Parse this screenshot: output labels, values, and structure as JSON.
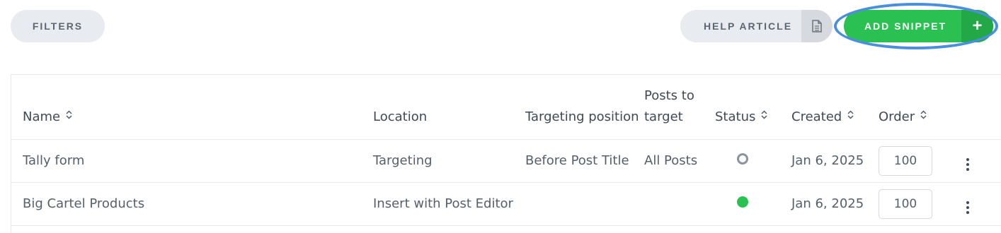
{
  "toolbar": {
    "filters_label": "FILTERS",
    "help_label": "HELP ARTICLE",
    "help_icon": "document-icon",
    "add_label": "ADD SNIPPET",
    "add_icon": "+"
  },
  "table": {
    "headers": {
      "name": "Name",
      "location": "Location",
      "targeting_position": "Targeting position",
      "posts_to_target": "Posts to target",
      "status": "Status",
      "created": "Created",
      "order": "Order"
    },
    "sort_glyph": "⌃⌄",
    "rows": [
      {
        "name": "Tally form",
        "location": "Targeting",
        "targeting_position": "Before Post Title",
        "posts_to_target": "All Posts",
        "status": "inactive",
        "created": "Jan 6, 2025",
        "order": "100"
      },
      {
        "name": "Big Cartel Products",
        "location": "Insert with Post Editor",
        "targeting_position": "",
        "posts_to_target": "",
        "status": "active",
        "created": "Jan 6, 2025",
        "order": "100"
      }
    ]
  },
  "colors": {
    "accent_green": "#2bc152",
    "highlight_blue": "#4a8fdc",
    "pill_gray": "#e8ebef"
  }
}
